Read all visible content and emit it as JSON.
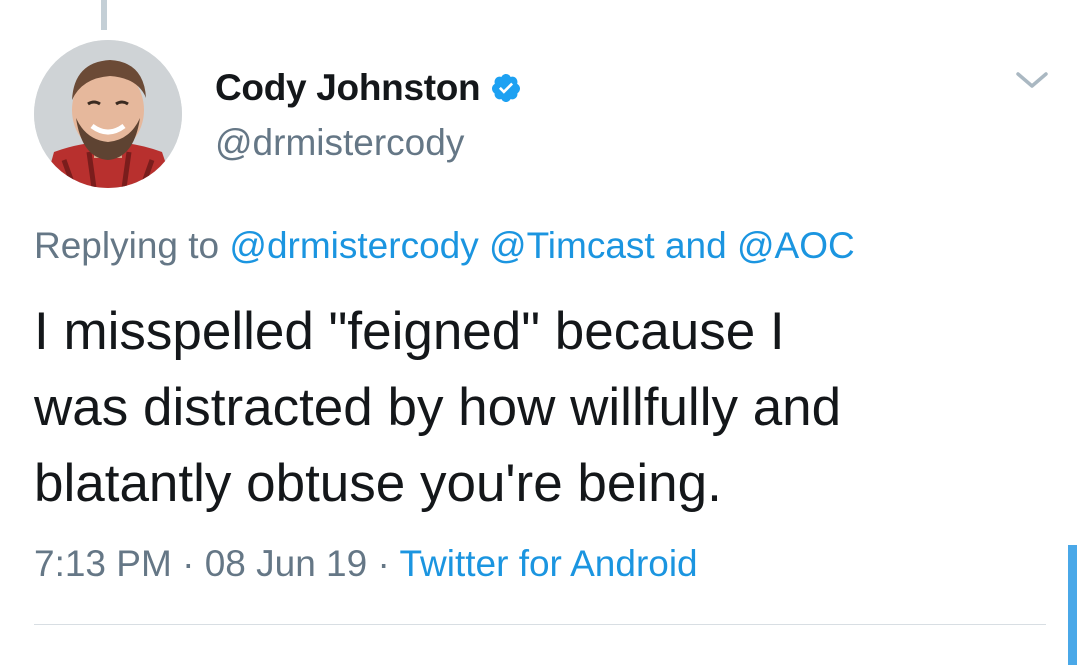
{
  "tweet": {
    "author": {
      "display_name": "Cody Johnston",
      "handle": "@drmistercody",
      "verified": true
    },
    "reply_label": "Replying to",
    "reply_to": [
      "@drmistercody",
      "@Timcast",
      "@AOC"
    ],
    "reply_and": "and",
    "text_lines": [
      "I misspelled \"feigned\" because I",
      "was distracted by how willfully and",
      "blatantly obtuse you're being."
    ],
    "time": "7:13 PM",
    "date": "08 Jun 19",
    "separator": "·",
    "source": "Twitter for Android"
  },
  "icons": {
    "verified": "verified-badge-icon",
    "menu": "chevron-down-icon"
  },
  "colors": {
    "link": "#1b95e0",
    "secondary_text": "#657786",
    "primary_text": "#14171a",
    "verified_badge": "#1da1f2",
    "scroll_indicator": "#4aa8e8"
  }
}
